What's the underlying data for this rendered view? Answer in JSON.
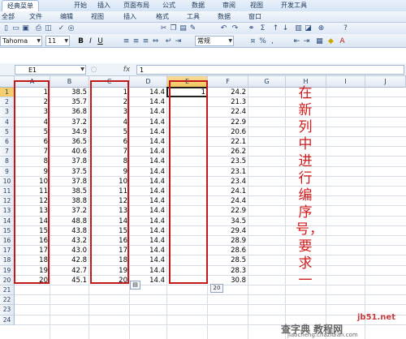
{
  "ribbon_tabs": [
    "经典菜单",
    "开始",
    "插入",
    "页面布局",
    "公式",
    "数据",
    "审阅",
    "视图",
    "开发工具"
  ],
  "menus": [
    "全部",
    "文件",
    "编辑",
    "视图",
    "插入",
    "格式",
    "工具",
    "数据",
    "窗口"
  ],
  "toolbar": {
    "font_name": "Tahoma",
    "font_size": "11",
    "number_format": "常规",
    "bold_label": "B",
    "italic_label": "I",
    "underline_label": "U",
    "percent_label": "%",
    "sum_label": "Σ",
    "comma_label": ","
  },
  "formula_bar": {
    "name_box": "E1",
    "fx_label": "fx",
    "formula": "1"
  },
  "columns": [
    "A",
    "B",
    "C",
    "D",
    "E",
    "F",
    "G",
    "H",
    "I",
    "J"
  ],
  "rows": [
    "1",
    "2",
    "3",
    "4",
    "5",
    "6",
    "7",
    "8",
    "9",
    "10",
    "11",
    "12",
    "13",
    "14",
    "15",
    "16",
    "17",
    "18",
    "19",
    "20",
    "21",
    "22",
    "23",
    "24"
  ],
  "col_a": [
    "1",
    "2",
    "3",
    "4",
    "5",
    "6",
    "7",
    "8",
    "9",
    "10",
    "11",
    "12",
    "13",
    "14",
    "15",
    "16",
    "17",
    "18",
    "19",
    "20"
  ],
  "col_b": [
    "38.5",
    "35.7",
    "36.8",
    "37.2",
    "34.9",
    "36.5",
    "40.6",
    "37.8",
    "37.5",
    "37.8",
    "38.5",
    "38.8",
    "37.2",
    "48.8",
    "43.8",
    "43.2",
    "43.0",
    "42.8",
    "42.7",
    "45.1"
  ],
  "col_c": [
    "1",
    "2",
    "3",
    "4",
    "5",
    "6",
    "7",
    "8",
    "9",
    "10",
    "11",
    "12",
    "13",
    "14",
    "15",
    "16",
    "17",
    "18",
    "19",
    "20"
  ],
  "col_d": [
    "14.4",
    "14.4",
    "14.4",
    "14.4",
    "14.4",
    "14.4",
    "14.4",
    "14.4",
    "14.4",
    "14.4",
    "14.4",
    "14.4",
    "14.4",
    "14.4",
    "14.4",
    "14.4",
    "14.4",
    "14.4",
    "14.4",
    "14.4"
  ],
  "col_e1": "1",
  "col_f": [
    "24.2",
    "21.3",
    "22.4",
    "22.9",
    "20.6",
    "22.1",
    "26.2",
    "23.5",
    "23.1",
    "23.4",
    "24.1",
    "24.4",
    "22.9",
    "34.5",
    "29.4",
    "28.9",
    "28.6",
    "28.5",
    "28.3",
    "30.8"
  ],
  "fill_handle_label": "20",
  "annotation": "在新列中进行编序号，要求一",
  "watermark": {
    "site": "jb51.net",
    "brand": "查字典 教程网",
    "url": "jiaocheng.chazidian.com"
  }
}
